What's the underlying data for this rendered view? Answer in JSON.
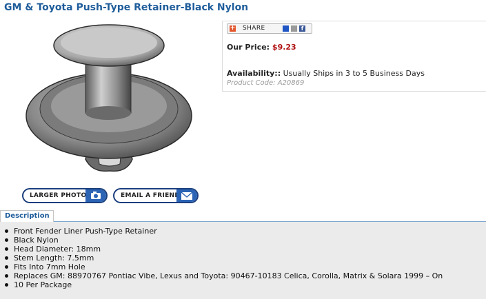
{
  "product": {
    "title": "GM & Toyota Push-Type Retainer-Black Nylon",
    "price_label": "Our Price:",
    "price": "$9.23",
    "availability_label": "Availability::",
    "availability": "Usually Ships in 3 to 5 Business Days",
    "product_code": "Product Code: A20869"
  },
  "buttons": {
    "larger_photo": "LARGER PHOTO",
    "email_friend": "EMAIL A FRIEND",
    "share": "SHARE"
  },
  "icons": {
    "larger_photo": "camera-icon",
    "email_friend": "envelope-icon",
    "share": "plus-icon",
    "share_services": [
      "delicious-icon",
      "digg-icon",
      "facebook-icon"
    ]
  },
  "colors": {
    "title": "#1f5d9a",
    "price": "#b01010",
    "button_border": "#1b3f7d",
    "button_icon_bg": "#2b63b5",
    "description_bg": "#ebebeb"
  },
  "tabs": [
    "Description"
  ],
  "description": [
    "Front Fender Liner Push-Type Retainer",
    "Black Nylon",
    "Head Diameter: 18mm",
    "Stem Length: 7.5mm",
    "Fits Into 7mm Hole",
    "Replaces GM: 88970767 Pontiac Vibe, Lexus and Toyota: 90467-10183 Celica, Corolla, Matrix & Solara 1999 – On",
    "10 Per Package"
  ]
}
